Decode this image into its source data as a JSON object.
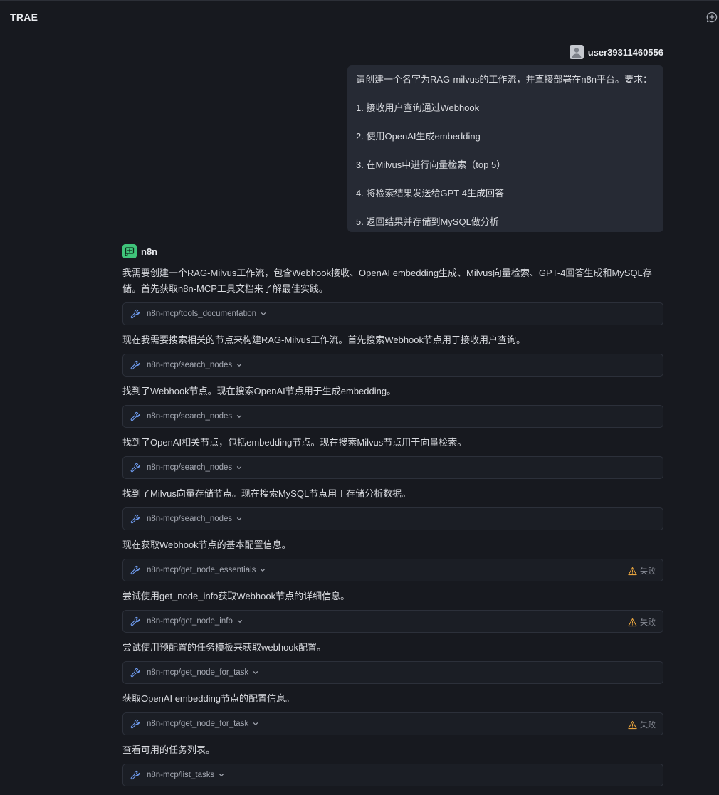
{
  "app": {
    "title": "TRAE"
  },
  "user": {
    "name": "user39311460556",
    "message_lines": [
      "请创建一个名字为RAG-milvus的工作流，并直接部署在n8n平台。要求：",
      "1. 接收用户查询通过Webhook",
      "2. 使用OpenAI生成embedding",
      "3. 在Milvus中进行向量检索（top 5）",
      "4. 将检索结果发送给GPT-4生成回答",
      "5. 返回结果并存储到MySQL做分析"
    ]
  },
  "assistant": {
    "name": "n8n",
    "steps": [
      {
        "text": "我需要创建一个RAG-Milvus工作流，包含Webhook接收、OpenAI embedding生成、Milvus向量检索、GPT-4回答生成和MySQL存储。首先获取n8n-MCP工具文档来了解最佳实践。",
        "tool": "n8n-mcp/tools_documentation",
        "status": ""
      },
      {
        "text": "现在我需要搜索相关的节点来构建RAG-Milvus工作流。首先搜索Webhook节点用于接收用户查询。",
        "tool": "n8n-mcp/search_nodes",
        "status": ""
      },
      {
        "text": "找到了Webhook节点。现在搜索OpenAI节点用于生成embedding。",
        "tool": "n8n-mcp/search_nodes",
        "status": ""
      },
      {
        "text": "找到了OpenAI相关节点，包括embedding节点。现在搜索Milvus节点用于向量检索。",
        "tool": "n8n-mcp/search_nodes",
        "status": ""
      },
      {
        "text": "找到了Milvus向量存储节点。现在搜索MySQL节点用于存储分析数据。",
        "tool": "n8n-mcp/search_nodes",
        "status": ""
      },
      {
        "text": "现在获取Webhook节点的基本配置信息。",
        "tool": "n8n-mcp/get_node_essentials",
        "status": "失败"
      },
      {
        "text": "尝试使用get_node_info获取Webhook节点的详细信息。",
        "tool": "n8n-mcp/get_node_info",
        "status": "失败"
      },
      {
        "text": "尝试使用预配置的任务模板来获取webhook配置。",
        "tool": "n8n-mcp/get_node_for_task",
        "status": ""
      },
      {
        "text": "获取OpenAI embedding节点的配置信息。",
        "tool": "n8n-mcp/get_node_for_task",
        "status": "失败"
      },
      {
        "text": "查看可用的任务列表。",
        "tool": "n8n-mcp/list_tasks",
        "status": ""
      }
    ]
  },
  "colors": {
    "background": "#17191f",
    "user_bubble": "#262a34",
    "tool_card": "#1b1e25",
    "accent_wrench": "#6f9cf0",
    "warning": "#e7a33e",
    "bot_avatar": "#3fc47a"
  }
}
